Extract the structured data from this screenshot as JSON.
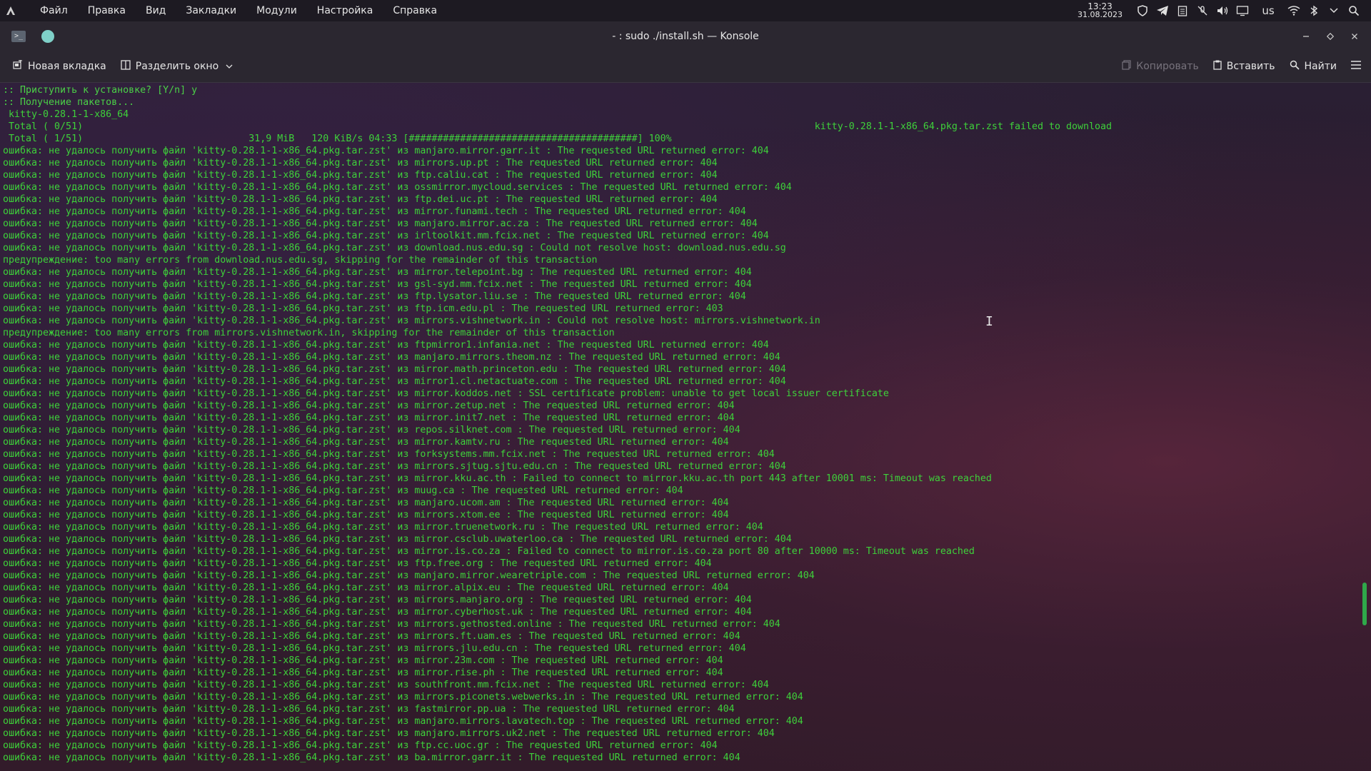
{
  "panel": {
    "menu": [
      "Файл",
      "Правка",
      "Вид",
      "Закладки",
      "Модули",
      "Настройка",
      "Справка"
    ],
    "time": "13:23",
    "date": "31.08.2023",
    "keyboard_layout": "us",
    "tray_icons": [
      "shield-icon",
      "telegram-icon",
      "clipboard-icon",
      "mic-muted-icon",
      "volume-icon",
      "display-icon",
      "keyboard-layout",
      "wifi-icon",
      "bluetooth-icon",
      "chevron-down-icon",
      "search-icon"
    ]
  },
  "window": {
    "title": "- : sudo ./install.sh — Konsole"
  },
  "toolbar": {
    "new_tab": "Новая вкладка",
    "split_view": "Разделить окно",
    "copy": "Копировать",
    "paste": "Вставить",
    "find": "Найти"
  },
  "terminal": {
    "lines": [
      ":: Приступить к установке? [Y/n] y",
      ":: Получение пакетов...",
      " kitty-0.28.1-1-x86_64",
      " Total ( 0/51)                                                                                                                                kitty-0.28.1-1-x86_64.pkg.tar.zst failed to download",
      " Total ( 1/51)                             31,9 MiB   120 KiB/s 04:33 [########################################] 100%",
      "ошибка: не удалось получить файл 'kitty-0.28.1-1-x86_64.pkg.tar.zst' из manjaro.mirror.garr.it : The requested URL returned error: 404",
      "ошибка: не удалось получить файл 'kitty-0.28.1-1-x86_64.pkg.tar.zst' из mirrors.up.pt : The requested URL returned error: 404",
      "ошибка: не удалось получить файл 'kitty-0.28.1-1-x86_64.pkg.tar.zst' из ftp.caliu.cat : The requested URL returned error: 404",
      "ошибка: не удалось получить файл 'kitty-0.28.1-1-x86_64.pkg.tar.zst' из ossmirror.mycloud.services : The requested URL returned error: 404",
      "ошибка: не удалось получить файл 'kitty-0.28.1-1-x86_64.pkg.tar.zst' из ftp.dei.uc.pt : The requested URL returned error: 404",
      "ошибка: не удалось получить файл 'kitty-0.28.1-1-x86_64.pkg.tar.zst' из mirror.funami.tech : The requested URL returned error: 404",
      "ошибка: не удалось получить файл 'kitty-0.28.1-1-x86_64.pkg.tar.zst' из manjaro.mirror.ac.za : The requested URL returned error: 404",
      "ошибка: не удалось получить файл 'kitty-0.28.1-1-x86_64.pkg.tar.zst' из irltoolkit.mm.fcix.net : The requested URL returned error: 404",
      "ошибка: не удалось получить файл 'kitty-0.28.1-1-x86_64.pkg.tar.zst' из download.nus.edu.sg : Could not resolve host: download.nus.edu.sg",
      "предупреждение: too many errors from download.nus.edu.sg, skipping for the remainder of this transaction",
      "ошибка: не удалось получить файл 'kitty-0.28.1-1-x86_64.pkg.tar.zst' из mirror.telepoint.bg : The requested URL returned error: 404",
      "ошибка: не удалось получить файл 'kitty-0.28.1-1-x86_64.pkg.tar.zst' из gsl-syd.mm.fcix.net : The requested URL returned error: 404",
      "ошибка: не удалось получить файл 'kitty-0.28.1-1-x86_64.pkg.tar.zst' из ftp.lysator.liu.se : The requested URL returned error: 404",
      "ошибка: не удалось получить файл 'kitty-0.28.1-1-x86_64.pkg.tar.zst' из ftp.icm.edu.pl : The requested URL returned error: 403",
      "ошибка: не удалось получить файл 'kitty-0.28.1-1-x86_64.pkg.tar.zst' из mirrors.vishnetwork.in : Could not resolve host: mirrors.vishnetwork.in",
      "предупреждение: too many errors from mirrors.vishnetwork.in, skipping for the remainder of this transaction",
      "ошибка: не удалось получить файл 'kitty-0.28.1-1-x86_64.pkg.tar.zst' из ftpmirror1.infania.net : The requested URL returned error: 404",
      "ошибка: не удалось получить файл 'kitty-0.28.1-1-x86_64.pkg.tar.zst' из manjaro.mirrors.theom.nz : The requested URL returned error: 404",
      "ошибка: не удалось получить файл 'kitty-0.28.1-1-x86_64.pkg.tar.zst' из mirror.math.princeton.edu : The requested URL returned error: 404",
      "ошибка: не удалось получить файл 'kitty-0.28.1-1-x86_64.pkg.tar.zst' из mirror1.cl.netactuate.com : The requested URL returned error: 404",
      "ошибка: не удалось получить файл 'kitty-0.28.1-1-x86_64.pkg.tar.zst' из mirror.koddos.net : SSL certificate problem: unable to get local issuer certificate",
      "ошибка: не удалось получить файл 'kitty-0.28.1-1-x86_64.pkg.tar.zst' из mirror.zetup.net : The requested URL returned error: 404",
      "ошибка: не удалось получить файл 'kitty-0.28.1-1-x86_64.pkg.tar.zst' из mirror.init7.net : The requested URL returned error: 404",
      "ошибка: не удалось получить файл 'kitty-0.28.1-1-x86_64.pkg.tar.zst' из repos.silknet.com : The requested URL returned error: 404",
      "ошибка: не удалось получить файл 'kitty-0.28.1-1-x86_64.pkg.tar.zst' из mirror.kamtv.ru : The requested URL returned error: 404",
      "ошибка: не удалось получить файл 'kitty-0.28.1-1-x86_64.pkg.tar.zst' из forksystems.mm.fcix.net : The requested URL returned error: 404",
      "ошибка: не удалось получить файл 'kitty-0.28.1-1-x86_64.pkg.tar.zst' из mirrors.sjtug.sjtu.edu.cn : The requested URL returned error: 404",
      "ошибка: не удалось получить файл 'kitty-0.28.1-1-x86_64.pkg.tar.zst' из mirror.kku.ac.th : Failed to connect to mirror.kku.ac.th port 443 after 10001 ms: Timeout was reached",
      "ошибка: не удалось получить файл 'kitty-0.28.1-1-x86_64.pkg.tar.zst' из muug.ca : The requested URL returned error: 404",
      "ошибка: не удалось получить файл 'kitty-0.28.1-1-x86_64.pkg.tar.zst' из manjaro.ucom.am : The requested URL returned error: 404",
      "ошибка: не удалось получить файл 'kitty-0.28.1-1-x86_64.pkg.tar.zst' из mirrors.xtom.ee : The requested URL returned error: 404",
      "ошибка: не удалось получить файл 'kitty-0.28.1-1-x86_64.pkg.tar.zst' из mirror.truenetwork.ru : The requested URL returned error: 404",
      "ошибка: не удалось получить файл 'kitty-0.28.1-1-x86_64.pkg.tar.zst' из mirror.csclub.uwaterloo.ca : The requested URL returned error: 404",
      "ошибка: не удалось получить файл 'kitty-0.28.1-1-x86_64.pkg.tar.zst' из mirror.is.co.za : Failed to connect to mirror.is.co.za port 80 after 10000 ms: Timeout was reached",
      "ошибка: не удалось получить файл 'kitty-0.28.1-1-x86_64.pkg.tar.zst' из ftp.free.org : The requested URL returned error: 404",
      "ошибка: не удалось получить файл 'kitty-0.28.1-1-x86_64.pkg.tar.zst' из manjaro.mirror.wearetriple.com : The requested URL returned error: 404",
      "ошибка: не удалось получить файл 'kitty-0.28.1-1-x86_64.pkg.tar.zst' из mirror.alpix.eu : The requested URL returned error: 404",
      "ошибка: не удалось получить файл 'kitty-0.28.1-1-x86_64.pkg.tar.zst' из mirrors.manjaro.org : The requested URL returned error: 404",
      "ошибка: не удалось получить файл 'kitty-0.28.1-1-x86_64.pkg.tar.zst' из mirror.cyberhost.uk : The requested URL returned error: 404",
      "ошибка: не удалось получить файл 'kitty-0.28.1-1-x86_64.pkg.tar.zst' из mirrors.gethosted.online : The requested URL returned error: 404",
      "ошибка: не удалось получить файл 'kitty-0.28.1-1-x86_64.pkg.tar.zst' из mirrors.ft.uam.es : The requested URL returned error: 404",
      "ошибка: не удалось получить файл 'kitty-0.28.1-1-x86_64.pkg.tar.zst' из mirrors.jlu.edu.cn : The requested URL returned error: 404",
      "ошибка: не удалось получить файл 'kitty-0.28.1-1-x86_64.pkg.tar.zst' из mirror.23m.com : The requested URL returned error: 404",
      "ошибка: не удалось получить файл 'kitty-0.28.1-1-x86_64.pkg.tar.zst' из mirror.rise.ph : The requested URL returned error: 404",
      "ошибка: не удалось получить файл 'kitty-0.28.1-1-x86_64.pkg.tar.zst' из southfront.mm.fcix.net : The requested URL returned error: 404",
      "ошибка: не удалось получить файл 'kitty-0.28.1-1-x86_64.pkg.tar.zst' из mirrors.piconets.webwerks.in : The requested URL returned error: 404",
      "ошибка: не удалось получить файл 'kitty-0.28.1-1-x86_64.pkg.tar.zst' из fastmirror.pp.ua : The requested URL returned error: 404",
      "ошибка: не удалось получить файл 'kitty-0.28.1-1-x86_64.pkg.tar.zst' из manjaro.mirrors.lavatech.top : The requested URL returned error: 404",
      "ошибка: не удалось получить файл 'kitty-0.28.1-1-x86_64.pkg.tar.zst' из manjaro.mirrors.uk2.net : The requested URL returned error: 404",
      "ошибка: не удалось получить файл 'kitty-0.28.1-1-x86_64.pkg.tar.zst' из ftp.cc.uoc.gr : The requested URL returned error: 404",
      "ошибка: не удалось получить файл 'kitty-0.28.1-1-x86_64.pkg.tar.zst' из ba.mirror.garr.it : The requested URL returned error: 404"
    ]
  },
  "colors": {
    "terminal_text": "#3ed13a",
    "panel_bg": "#1d1a22",
    "window_bg": "#2b2730",
    "accent": "#7fd0c8"
  }
}
